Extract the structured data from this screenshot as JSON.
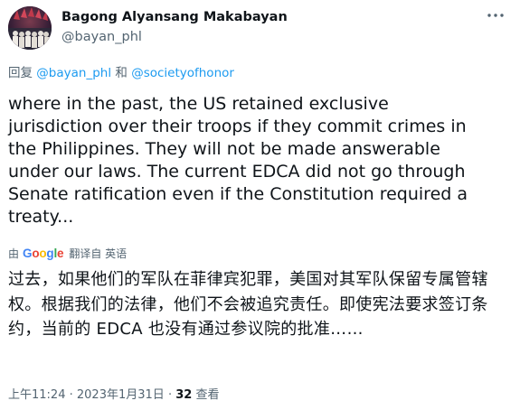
{
  "author": {
    "display_name": "Bagong Alyansang Makabayan",
    "handle": "@bayan_phl"
  },
  "reply_to": {
    "prefix": "回复",
    "mention_1": "@bayan_phl",
    "conjunction": "和",
    "mention_2": "@societyofhonor"
  },
  "tweet": {
    "text": "where in the past, the US retained exclusive\njurisdiction over their troops if they commit crimes in\nthe Philippines. They will not be made answerable\nunder our laws. The current EDCA did not go through\nSenate ratification even if the Constitution required a\ntreaty..."
  },
  "translation": {
    "by_label": "由",
    "provider": "Google",
    "action_label": "翻译自 英语",
    "text": "过去，如果他们的军队在菲律宾犯罪，美国对其军队保留专属管辖权。根据我们的法律，他们不会被追究责任。即使宪法要求签订条约，当前的 EDCA 也没有通过参议院的批准……",
    "google_colors": [
      "#4285f4",
      "#ea4335",
      "#fbbc05",
      "#4285f4",
      "#34a853",
      "#ea4335"
    ]
  },
  "meta": {
    "time": "上午11:24",
    "separator": "·",
    "date": "2023年1月31日",
    "views_count": "32",
    "views_label": "查看"
  },
  "icons": {
    "more": "more-horizontal-icon",
    "avatar": "avatar-image"
  },
  "colors": {
    "link_blue": "#1d9bf0",
    "secondary_text": "#536471",
    "primary_text": "#0f1419"
  }
}
